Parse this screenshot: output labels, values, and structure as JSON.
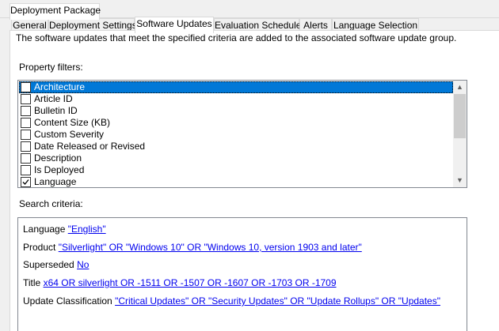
{
  "window": {
    "outer_tab": "Deployment Package"
  },
  "tabs": [
    "General",
    "Deployment Settings",
    "Software Updates",
    "Evaluation Schedule",
    "Alerts",
    "Language Selection"
  ],
  "active_tab": "Software Updates",
  "description": "The software updates that meet the specified criteria are added to the associated software update group.",
  "property_filters": {
    "label": "Property filters:",
    "items": [
      {
        "label": "Architecture",
        "checked": false,
        "selected": true
      },
      {
        "label": "Article ID",
        "checked": false
      },
      {
        "label": "Bulletin ID",
        "checked": false
      },
      {
        "label": "Content Size (KB)",
        "checked": false
      },
      {
        "label": "Custom Severity",
        "checked": false
      },
      {
        "label": "Date Released or Revised",
        "checked": false
      },
      {
        "label": "Description",
        "checked": false
      },
      {
        "label": "Is Deployed",
        "checked": false
      },
      {
        "label": "Language",
        "checked": true
      }
    ]
  },
  "search_criteria": {
    "label": "Search criteria:",
    "rows": [
      {
        "name": "Language",
        "value": "\"English\""
      },
      {
        "name": "Product",
        "value": "\"Silverlight\" OR \"Windows 10\" OR \"Windows 10, version 1903 and later\""
      },
      {
        "name": "Superseded",
        "value": "No"
      },
      {
        "name": "Title",
        "value": "x64 OR silverlight OR -1511 OR -1507 OR -1607 OR -1703 OR -1709"
      },
      {
        "name": "Update Classification",
        "value": "\"Critical Updates\" OR \"Security Updates\" OR \"Update Rollups\" OR \"Updates\""
      }
    ]
  }
}
